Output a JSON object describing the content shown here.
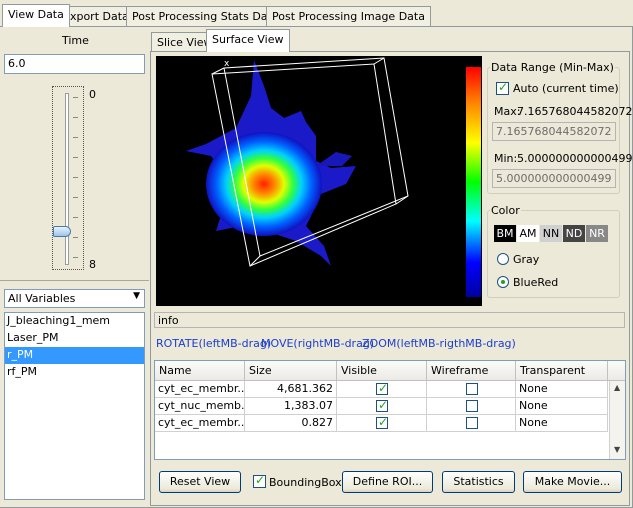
{
  "tabs": [
    "View Data",
    "Export Data",
    "Post Processing Stats Data",
    "Post Processing Image Data"
  ],
  "time": {
    "label": "Time",
    "value": "6.0",
    "slider_min": "0",
    "slider_max": "8",
    "slider_fraction": 0.83
  },
  "variables": {
    "dropdown_value": "All Variables",
    "items": [
      "J_bleaching1_mem",
      "Laser_PM",
      "r_PM",
      "rf_PM"
    ],
    "selected_index": 2
  },
  "view_tabs": [
    "Slice View",
    "Surface View"
  ],
  "data_range": {
    "title": "Data Range (Min-Max)",
    "auto_label": "Auto (current time)",
    "max_label": "Max:",
    "max_value": "7.165768044582072",
    "max_field": "7.165768044582072",
    "min_label": "Min:",
    "min_value": "5.000000000000499",
    "min_field": "5.000000000000499"
  },
  "color": {
    "title": "Color",
    "buttons": [
      "BM",
      "AM",
      "NN",
      "ND",
      "NR"
    ],
    "gray_label": "Gray",
    "bluered_label": "BlueRed"
  },
  "info": {
    "label": "info",
    "hint_rotate": "ROTATE(leftMB-drag)",
    "hint_move": "MOVE(rightMB-drag)",
    "hint_zoom": "ZOOM(leftMB-rigthMB-drag)"
  },
  "table": {
    "headers": [
      "Name",
      "Size",
      "Visible",
      "Wireframe",
      "Transparent"
    ],
    "rows": [
      {
        "name": "cyt_ec_membr...",
        "size": "4,681.362",
        "visible": true,
        "wireframe": false,
        "transparent": "None"
      },
      {
        "name": "cyt_nuc_memb...",
        "size": "1,383.07",
        "visible": true,
        "wireframe": false,
        "transparent": "None"
      },
      {
        "name": "cyt_ec_membr...",
        "size": "0.827",
        "visible": true,
        "wireframe": false,
        "transparent": "None"
      }
    ]
  },
  "buttons": {
    "reset_view": "Reset View",
    "bounding_box": "BoundingBox",
    "define_roi": "Define ROI...",
    "statistics": "Statistics",
    "make_movie": "Make Movie..."
  },
  "viewer": {
    "axis_label": "x"
  },
  "colors": {
    "selection": "#3399ff",
    "viewer_bg": "#000000"
  }
}
